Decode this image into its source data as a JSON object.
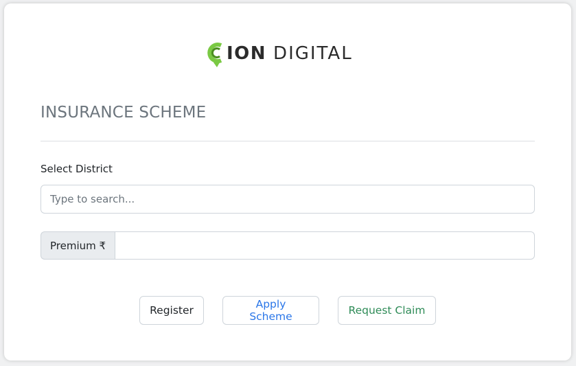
{
  "logo": {
    "ion": "ION",
    "digital": "DIGITAL",
    "accent_color": "#7ac943"
  },
  "form": {
    "title": "INSURANCE SCHEME",
    "district_label": "Select District",
    "district_placeholder": "Type to search...",
    "district_value": "",
    "premium_label": "Premium ₹",
    "premium_value": ""
  },
  "actions": {
    "register": "Register",
    "apply": "Apply Scheme",
    "claim": "Request Claim"
  },
  "colors": {
    "apply_text": "#2a76e8",
    "claim_text": "#2e8b57",
    "title_text": "#6c757d"
  }
}
